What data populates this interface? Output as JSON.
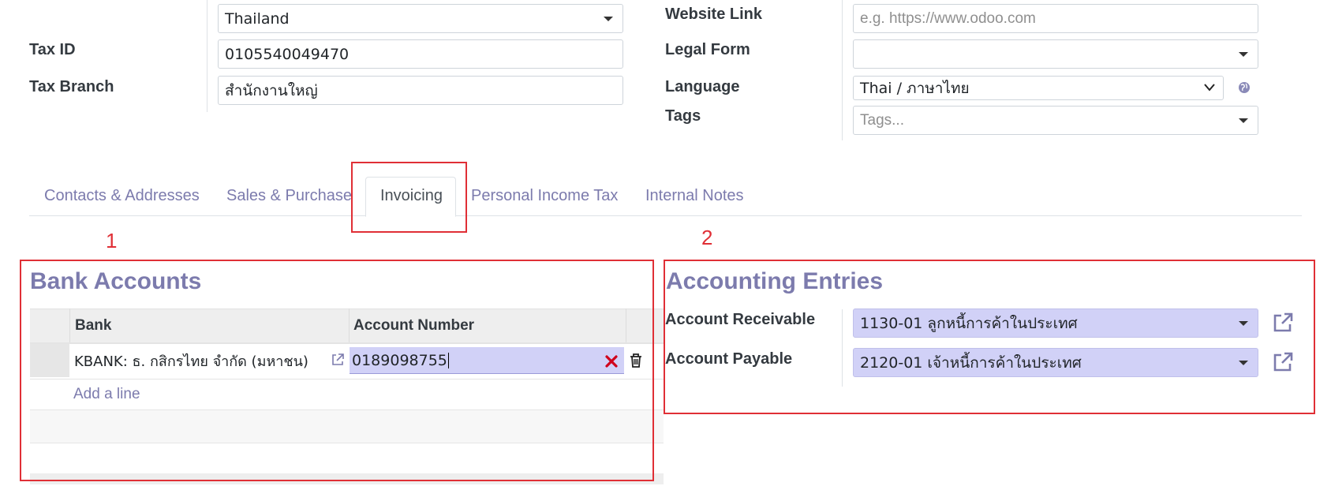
{
  "top_fields": {
    "country_value": "Thailand",
    "tax_id_label": "Tax ID",
    "tax_id_value": "0105540049470",
    "tax_branch_label": "Tax Branch",
    "tax_branch_value": "สำนักงานใหญ่",
    "website_label": "Website Link",
    "website_placeholder": "e.g. https://www.odoo.com",
    "legal_form_label": "Legal Form",
    "legal_form_value": "",
    "language_label": "Language",
    "language_value": "Thai / ภาษาไทย",
    "tags_label": "Tags",
    "tags_placeholder": "Tags..."
  },
  "tabs": [
    {
      "label": "Contacts & Addresses",
      "active": false
    },
    {
      "label": "Sales & Purchase",
      "active": false
    },
    {
      "label": "Invoicing",
      "active": true
    },
    {
      "label": "Personal Income Tax",
      "active": false
    },
    {
      "label": "Internal Notes",
      "active": false
    }
  ],
  "annotations": [
    "1",
    "2"
  ],
  "bank_accounts": {
    "title": "Bank Accounts",
    "columns": [
      "Bank",
      "Account Number"
    ],
    "rows": [
      {
        "bank": "KBANK: ธ. กสิกรไทย จำกัด (มหาชน)",
        "account_number": "0189098755"
      }
    ],
    "add_line": "Add a line"
  },
  "accounting_entries": {
    "title": "Accounting Entries",
    "receivable_label": "Account Receivable",
    "receivable_value": "1130-01 ลูกหนี้การค้าในประเทศ",
    "payable_label": "Account Payable",
    "payable_value": "2120-01 เจ้าหนี้การค้าในประเทศ"
  },
  "colors": {
    "accent": "#7c7bad",
    "highlight_red": "#e02f36",
    "selected_field_bg": "#d1d1f7"
  }
}
